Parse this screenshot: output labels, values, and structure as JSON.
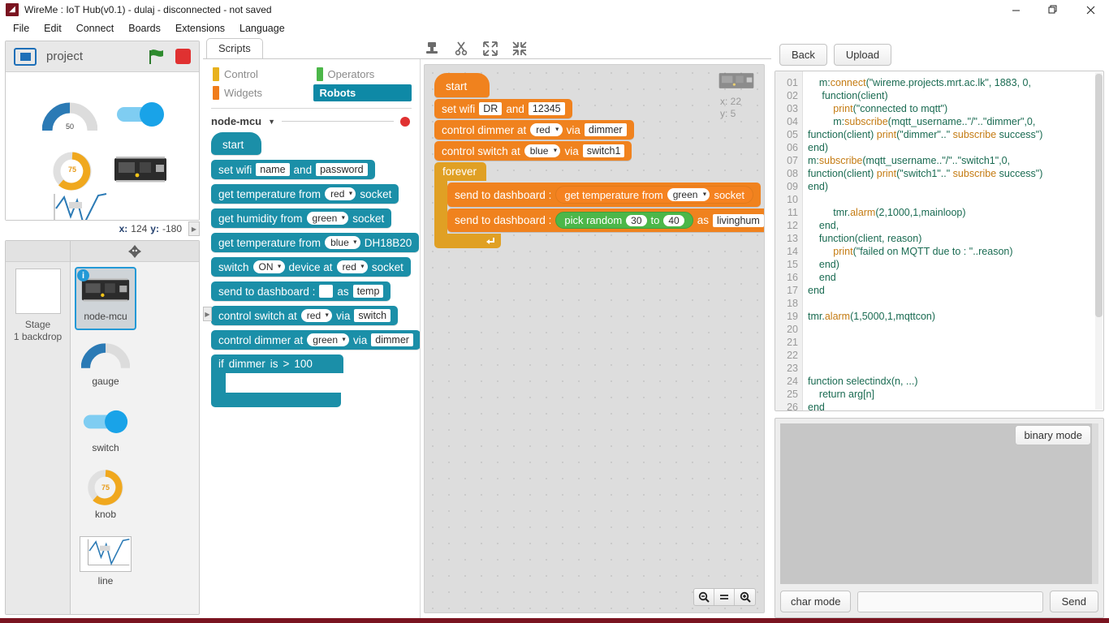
{
  "window": {
    "title": "WireMe : IoT Hub(v0.1) - dulaj - disconnected - not saved",
    "app_icon": "wireme-logo-icon",
    "minimize": "minimize-icon",
    "maximize": "restore-icon",
    "close": "close-icon"
  },
  "menu": [
    "File",
    "Edit",
    "Connect",
    "Boards",
    "Extensions",
    "Language"
  ],
  "stage": {
    "project_name": "project",
    "green_flag": "green-flag-icon",
    "stop": "stop-icon",
    "logo": "stage-logo-icon",
    "coords": {
      "x_label": "x:",
      "x_value": "124",
      "y_label": "y:",
      "y_value": "-180"
    },
    "widgets": [
      {
        "name": "gauge",
        "value": "50",
        "type": "half-gauge"
      },
      {
        "name": "switch",
        "value": "on",
        "type": "toggle"
      },
      {
        "name": "knob",
        "value": "75",
        "type": "donut"
      },
      {
        "name": "node-mcu",
        "type": "board"
      },
      {
        "name": "line",
        "type": "line-chart"
      }
    ]
  },
  "sprites": {
    "stage_label_line1": "Stage",
    "stage_label_line2": "1 backdrop",
    "header_icon": "new-sprite-icon",
    "items": [
      {
        "label": "node-mcu",
        "selected": true,
        "info_badge": "i",
        "thumb": "board-icon"
      },
      {
        "label": "gauge",
        "selected": false,
        "thumb": "gauge-icon"
      },
      {
        "label": "switch",
        "selected": false,
        "thumb": "switch-icon"
      },
      {
        "label": "knob",
        "selected": false,
        "thumb": "knob-icon"
      },
      {
        "label": "line",
        "selected": false,
        "thumb": "line-chart-icon"
      }
    ]
  },
  "tabs": {
    "scripts": "Scripts"
  },
  "toolbar_icons": [
    "stamp-icon",
    "scissors-icon",
    "grow-icon",
    "shrink-icon"
  ],
  "palette": {
    "categories": [
      {
        "label": "Control",
        "color": "#e8b11c",
        "active": false
      },
      {
        "label": "Operators",
        "color": "#4cb749",
        "active": false
      },
      {
        "label": "Widgets",
        "color": "#f07c1b",
        "active": false
      },
      {
        "label": "Robots",
        "color": "#0e89a6",
        "active": true
      }
    ],
    "selector": {
      "name": "node-mcu",
      "caret": "chevron-down-icon",
      "status_dot": "#e03131"
    },
    "blocks": [
      {
        "id": "start",
        "shape": "hat",
        "parts": [
          {
            "t": "label",
            "v": "start"
          }
        ]
      },
      {
        "id": "set-wifi",
        "shape": "stack",
        "parts": [
          {
            "t": "label",
            "v": "set wifi"
          },
          {
            "t": "field",
            "v": "name"
          },
          {
            "t": "label",
            "v": "and"
          },
          {
            "t": "field",
            "v": "password"
          }
        ]
      },
      {
        "id": "get-temperature-socket",
        "shape": "stack",
        "parts": [
          {
            "t": "label",
            "v": "get temperature from"
          },
          {
            "t": "dropdown",
            "v": "red"
          },
          {
            "t": "label",
            "v": "socket"
          }
        ]
      },
      {
        "id": "get-humidity-socket",
        "shape": "stack",
        "parts": [
          {
            "t": "label",
            "v": "get humidity from"
          },
          {
            "t": "dropdown",
            "v": "green"
          },
          {
            "t": "label",
            "v": "socket"
          }
        ]
      },
      {
        "id": "get-temperature-dh18b20",
        "shape": "stack",
        "parts": [
          {
            "t": "label",
            "v": "get temperature from"
          },
          {
            "t": "dropdown",
            "v": "blue"
          },
          {
            "t": "label",
            "v": "DH18B20"
          }
        ]
      },
      {
        "id": "switch-device",
        "shape": "stack",
        "parts": [
          {
            "t": "label",
            "v": "switch"
          },
          {
            "t": "dropdown",
            "v": "ON"
          },
          {
            "t": "label",
            "v": "device at"
          },
          {
            "t": "dropdown",
            "v": "red"
          },
          {
            "t": "label",
            "v": "socket"
          }
        ]
      },
      {
        "id": "send-to-dashboard",
        "shape": "stack",
        "parts": [
          {
            "t": "label",
            "v": "send to dashboard :"
          },
          {
            "t": "blank",
            "v": ""
          },
          {
            "t": "label",
            "v": "as"
          },
          {
            "t": "field",
            "v": "temp"
          }
        ]
      },
      {
        "id": "control-switch",
        "shape": "stack",
        "parts": [
          {
            "t": "label",
            "v": "control switch at"
          },
          {
            "t": "dropdown",
            "v": "red"
          },
          {
            "t": "label",
            "v": "via"
          },
          {
            "t": "field",
            "v": "switch"
          }
        ]
      },
      {
        "id": "control-dimmer",
        "shape": "stack",
        "parts": [
          {
            "t": "label",
            "v": "control dimmer at"
          },
          {
            "t": "dropdown",
            "v": "green"
          },
          {
            "t": "label",
            "v": "via"
          },
          {
            "t": "field",
            "v": "dimmer"
          }
        ]
      }
    ],
    "if_block": {
      "if_label": "if",
      "variable": "dimmer",
      "is_label": "is",
      "operator": ">",
      "value": "100"
    }
  },
  "canvas": {
    "coords": {
      "x_label": "x:",
      "x_value": "22",
      "y_label": "y:",
      "y_value": "5"
    },
    "sprite_badge": "node-mcu-board-icon",
    "zoom": {
      "out": "zoom-out-icon",
      "reset": "zoom-reset-icon",
      "in": "zoom-in-icon"
    },
    "script": {
      "start": "start",
      "set_wifi": {
        "label": "set wifi",
        "ssid": "DR",
        "and_label": "and",
        "password": "12345"
      },
      "control_dimmer": {
        "label": "control dimmer at",
        "socket": "red",
        "via_label": "via",
        "name": "dimmer"
      },
      "control_switch": {
        "label": "control switch at",
        "socket": "blue",
        "via_label": "via",
        "name": "switch1"
      },
      "forever": "forever",
      "loop_body": [
        {
          "prefix": "send to dashboard :",
          "reporter_type": "orange",
          "reporter_label": "get temperature from",
          "reporter_dropdown": "green",
          "reporter_suffix": "socket"
        },
        {
          "prefix": "send to dashboard :",
          "reporter_type": "green",
          "reporter_label": "pick random",
          "reporter_from": "30",
          "reporter_to_label": "to",
          "reporter_to": "40",
          "as_label": "as",
          "field": "livinghum"
        }
      ]
    }
  },
  "right": {
    "back_label": "Back",
    "upload_label": "Upload",
    "code": {
      "line_numbers": [
        "01",
        "02",
        "03",
        "04",
        "05",
        "06",
        "07",
        "08",
        "09",
        "10",
        "11",
        "12",
        "13",
        "14",
        "15",
        "16",
        "17",
        "18",
        "19",
        "20",
        "21",
        "22",
        "23",
        "24",
        "25",
        "26"
      ],
      "lines": [
        "    m:connect(\"wireme.projects.mrt.ac.lk\", 1883, 0,",
        "     function(client)",
        "         print(\"connected to mqtt\")",
        "         m:subscribe(mqtt_username..\"/\"..\"dimmer\",0,",
        "function(client) print(\"dimmer\"..\" subscribe success\")",
        "end)",
        "m:subscribe(mqtt_username..\"/\"..\"switch1\",0,",
        "function(client) print(\"switch1\"..\" subscribe success\")",
        "end)",
        "",
        "         tmr.alarm(2,1000,1,mainloop)",
        "    end,",
        "    function(client, reason)",
        "         print(\"failed on MQTT due to : \"..reason)",
        "    end)",
        "    end",
        "end",
        "",
        "tmr.alarm(1,5000,1,mqttcon)",
        "",
        "",
        "",
        "",
        "function selectindx(n, ...)",
        "    return arg[n]",
        "end"
      ]
    },
    "console": {
      "binary_mode": "binary mode",
      "char_mode": "char mode",
      "send": "Send",
      "input_value": ""
    }
  }
}
